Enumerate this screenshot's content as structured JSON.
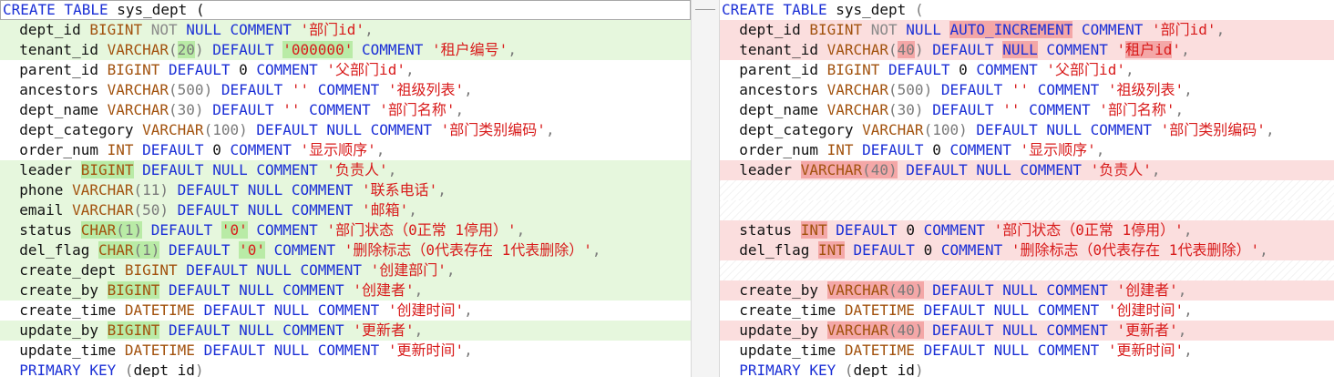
{
  "colors": {
    "keyword": "#1b2fd6",
    "type": "#a2520e",
    "string": "#d81b1b",
    "left_changed_bg": "#e6f7dd",
    "left_highlight": "#b9eba6",
    "right_changed_bg": "#fbdede",
    "right_highlight": "#f4a7a7"
  },
  "left": {
    "lines": [
      {
        "changed": false,
        "first": true,
        "segs": [
          [
            "kw",
            "CREATE TABLE "
          ],
          [
            "id",
            "sys_dept "
          ],
          [
            "id",
            "("
          ]
        ]
      },
      {
        "changed": true,
        "segs": [
          [
            "id",
            "  dept_id "
          ],
          [
            "ty",
            "BIGINT "
          ],
          [
            "dim",
            "NOT "
          ],
          [
            "kw",
            "NULL COMMENT "
          ],
          [
            "st",
            "'部门id'"
          ],
          [
            "pn",
            ","
          ]
        ]
      },
      {
        "changed": true,
        "segs": [
          [
            "id",
            "  tenant_id "
          ],
          [
            "ty",
            "VARCHAR"
          ],
          [
            "pn",
            "("
          ],
          [
            "hl",
            "20"
          ],
          [
            "pn",
            ") "
          ],
          [
            "kw",
            "DEFAULT "
          ],
          [
            "hlst",
            "'000000'"
          ],
          [
            "kw",
            " COMMENT "
          ],
          [
            "st",
            "'租户编号'"
          ],
          [
            "pn",
            ","
          ]
        ]
      },
      {
        "changed": false,
        "segs": [
          [
            "id",
            "  parent_id "
          ],
          [
            "ty",
            "BIGINT "
          ],
          [
            "kw",
            "DEFAULT "
          ],
          [
            "id",
            "0 "
          ],
          [
            "kw",
            "COMMENT "
          ],
          [
            "st",
            "'父部门id'"
          ],
          [
            "pn",
            ","
          ]
        ]
      },
      {
        "changed": false,
        "segs": [
          [
            "id",
            "  ancestors "
          ],
          [
            "ty",
            "VARCHAR"
          ],
          [
            "pn",
            "(500) "
          ],
          [
            "kw",
            "DEFAULT "
          ],
          [
            "st",
            "'' "
          ],
          [
            "kw",
            "COMMENT "
          ],
          [
            "st",
            "'祖级列表'"
          ],
          [
            "pn",
            ","
          ]
        ]
      },
      {
        "changed": false,
        "segs": [
          [
            "id",
            "  dept_name "
          ],
          [
            "ty",
            "VARCHAR"
          ],
          [
            "pn",
            "(30) "
          ],
          [
            "kw",
            "DEFAULT "
          ],
          [
            "st",
            "'' "
          ],
          [
            "kw",
            "COMMENT "
          ],
          [
            "st",
            "'部门名称'"
          ],
          [
            "pn",
            ","
          ]
        ]
      },
      {
        "changed": false,
        "segs": [
          [
            "id",
            "  dept_category "
          ],
          [
            "ty",
            "VARCHAR"
          ],
          [
            "pn",
            "(100) "
          ],
          [
            "kw",
            "DEFAULT NULL COMMENT "
          ],
          [
            "st",
            "'部门类别编码'"
          ],
          [
            "pn",
            ","
          ]
        ]
      },
      {
        "changed": false,
        "segs": [
          [
            "id",
            "  order_num "
          ],
          [
            "ty",
            "INT "
          ],
          [
            "kw",
            "DEFAULT "
          ],
          [
            "id",
            "0 "
          ],
          [
            "kw",
            "COMMENT "
          ],
          [
            "st",
            "'显示顺序'"
          ],
          [
            "pn",
            ","
          ]
        ]
      },
      {
        "changed": true,
        "segs": [
          [
            "id",
            "  leader "
          ],
          [
            "hlty",
            "BIGINT"
          ],
          [
            "kw",
            " DEFAULT NULL COMMENT "
          ],
          [
            "st",
            "'负责人'"
          ],
          [
            "pn",
            ","
          ]
        ]
      },
      {
        "changed": true,
        "segs": [
          [
            "id",
            "  phone "
          ],
          [
            "ty",
            "VARCHAR"
          ],
          [
            "pn",
            "(11) "
          ],
          [
            "kw",
            "DEFAULT NULL COMMENT "
          ],
          [
            "st",
            "'联系电话'"
          ],
          [
            "pn",
            ","
          ]
        ]
      },
      {
        "changed": true,
        "segs": [
          [
            "id",
            "  email "
          ],
          [
            "ty",
            "VARCHAR"
          ],
          [
            "pn",
            "(50) "
          ],
          [
            "kw",
            "DEFAULT NULL COMMENT "
          ],
          [
            "st",
            "'邮箱'"
          ],
          [
            "pn",
            ","
          ]
        ]
      },
      {
        "changed": true,
        "segs": [
          [
            "id",
            "  status "
          ],
          [
            "hlty",
            "CHAR"
          ],
          [
            "hl",
            "(1)"
          ],
          [
            "kw",
            " DEFAULT "
          ],
          [
            "hlst",
            "'0'"
          ],
          [
            "kw",
            " COMMENT "
          ],
          [
            "st",
            "'部门状态（0正常 1停用）'"
          ],
          [
            "pn",
            ","
          ]
        ]
      },
      {
        "changed": true,
        "segs": [
          [
            "id",
            "  del_flag "
          ],
          [
            "hlty",
            "CHAR"
          ],
          [
            "hl",
            "(1)"
          ],
          [
            "kw",
            " DEFAULT "
          ],
          [
            "hlst",
            "'0'"
          ],
          [
            "kw",
            " COMMENT "
          ],
          [
            "st",
            "'删除标志（0代表存在 1代表删除）'"
          ],
          [
            "pn",
            ","
          ]
        ]
      },
      {
        "changed": true,
        "segs": [
          [
            "id",
            "  create_dept "
          ],
          [
            "ty",
            "BIGINT "
          ],
          [
            "kw",
            "DEFAULT NULL COMMENT "
          ],
          [
            "st",
            "'创建部门'"
          ],
          [
            "pn",
            ","
          ]
        ]
      },
      {
        "changed": true,
        "segs": [
          [
            "id",
            "  create_by "
          ],
          [
            "hlty",
            "BIGINT"
          ],
          [
            "kw",
            " DEFAULT NULL COMMENT "
          ],
          [
            "st",
            "'创建者'"
          ],
          [
            "pn",
            ","
          ]
        ]
      },
      {
        "changed": false,
        "segs": [
          [
            "id",
            "  create_time "
          ],
          [
            "ty",
            "DATETIME "
          ],
          [
            "kw",
            "DEFAULT NULL COMMENT "
          ],
          [
            "st",
            "'创建时间'"
          ],
          [
            "pn",
            ","
          ]
        ]
      },
      {
        "changed": true,
        "segs": [
          [
            "id",
            "  update_by "
          ],
          [
            "hlty",
            "BIGINT"
          ],
          [
            "kw",
            " DEFAULT NULL COMMENT "
          ],
          [
            "st",
            "'更新者'"
          ],
          [
            "pn",
            ","
          ]
        ]
      },
      {
        "changed": false,
        "segs": [
          [
            "id",
            "  update_time "
          ],
          [
            "ty",
            "DATETIME "
          ],
          [
            "kw",
            "DEFAULT NULL COMMENT "
          ],
          [
            "st",
            "'更新时间'"
          ],
          [
            "pn",
            ","
          ]
        ]
      },
      {
        "changed": false,
        "segs": [
          [
            "kw",
            "  PRIMARY KEY "
          ],
          [
            "pn",
            "("
          ],
          [
            "id",
            "dept_id"
          ],
          [
            "pn",
            ")"
          ]
        ]
      }
    ]
  },
  "right": {
    "lines": [
      {
        "changed": false,
        "segs": [
          [
            "kw",
            "CREATE TABLE "
          ],
          [
            "id",
            "sys_dept "
          ],
          [
            "pn",
            "("
          ]
        ]
      },
      {
        "changed": true,
        "segs": [
          [
            "id",
            "  dept_id "
          ],
          [
            "ty",
            "BIGINT "
          ],
          [
            "dim",
            "NOT "
          ],
          [
            "kw",
            "NULL "
          ],
          [
            "hlkw",
            "AUTO_INCREMENT"
          ],
          [
            "kw",
            " COMMENT "
          ],
          [
            "st",
            "'部门id'"
          ],
          [
            "pn",
            ","
          ]
        ]
      },
      {
        "changed": true,
        "segs": [
          [
            "id",
            "  tenant_id "
          ],
          [
            "ty",
            "VARCHAR"
          ],
          [
            "pn",
            "("
          ],
          [
            "hl",
            "40"
          ],
          [
            "pn",
            ") "
          ],
          [
            "kw",
            "DEFAULT "
          ],
          [
            "hlkw",
            "NULL"
          ],
          [
            "kw",
            " COMMENT "
          ],
          [
            "st",
            "'"
          ],
          [
            "hlst",
            "租户id"
          ],
          [
            "st",
            "'"
          ],
          [
            "pn",
            ","
          ]
        ]
      },
      {
        "changed": false,
        "segs": [
          [
            "id",
            "  parent_id "
          ],
          [
            "ty",
            "BIGINT "
          ],
          [
            "kw",
            "DEFAULT "
          ],
          [
            "id",
            "0 "
          ],
          [
            "kw",
            "COMMENT "
          ],
          [
            "st",
            "'父部门id'"
          ],
          [
            "pn",
            ","
          ]
        ]
      },
      {
        "changed": false,
        "segs": [
          [
            "id",
            "  ancestors "
          ],
          [
            "ty",
            "VARCHAR"
          ],
          [
            "pn",
            "(500) "
          ],
          [
            "kw",
            "DEFAULT "
          ],
          [
            "st",
            "'' "
          ],
          [
            "kw",
            "COMMENT "
          ],
          [
            "st",
            "'祖级列表'"
          ],
          [
            "pn",
            ","
          ]
        ]
      },
      {
        "changed": false,
        "segs": [
          [
            "id",
            "  dept_name "
          ],
          [
            "ty",
            "VARCHAR"
          ],
          [
            "pn",
            "(30) "
          ],
          [
            "kw",
            "DEFAULT "
          ],
          [
            "st",
            "'' "
          ],
          [
            "kw",
            "COMMENT "
          ],
          [
            "st",
            "'部门名称'"
          ],
          [
            "pn",
            ","
          ]
        ]
      },
      {
        "changed": false,
        "segs": [
          [
            "id",
            "  dept_category "
          ],
          [
            "ty",
            "VARCHAR"
          ],
          [
            "pn",
            "(100) "
          ],
          [
            "kw",
            "DEFAULT NULL COMMENT "
          ],
          [
            "st",
            "'部门类别编码'"
          ],
          [
            "pn",
            ","
          ]
        ]
      },
      {
        "changed": false,
        "segs": [
          [
            "id",
            "  order_num "
          ],
          [
            "ty",
            "INT "
          ],
          [
            "kw",
            "DEFAULT "
          ],
          [
            "id",
            "0 "
          ],
          [
            "kw",
            "COMMENT "
          ],
          [
            "st",
            "'显示顺序'"
          ],
          [
            "pn",
            ","
          ]
        ]
      },
      {
        "changed": true,
        "segs": [
          [
            "id",
            "  leader "
          ],
          [
            "hlty",
            "VARCHAR"
          ],
          [
            "hl",
            "(40)"
          ],
          [
            "kw",
            " DEFAULT NULL COMMENT "
          ],
          [
            "st",
            "'负责人'"
          ],
          [
            "pn",
            ","
          ]
        ]
      },
      {
        "blank": true,
        "segs": []
      },
      {
        "blank": true,
        "segs": []
      },
      {
        "changed": true,
        "segs": [
          [
            "id",
            "  status "
          ],
          [
            "hlty",
            "INT"
          ],
          [
            "kw",
            " DEFAULT "
          ],
          [
            "id",
            "0 "
          ],
          [
            "kw",
            "COMMENT "
          ],
          [
            "st",
            "'部门状态（0正常 1停用）'"
          ],
          [
            "pn",
            ","
          ]
        ]
      },
      {
        "changed": true,
        "segs": [
          [
            "id",
            "  del_flag "
          ],
          [
            "hlty",
            "INT"
          ],
          [
            "kw",
            " DEFAULT "
          ],
          [
            "id",
            "0 "
          ],
          [
            "kw",
            "COMMENT "
          ],
          [
            "st",
            "'删除标志（0代表存在 1代表删除）'"
          ],
          [
            "pn",
            ","
          ]
        ]
      },
      {
        "blank": true,
        "segs": []
      },
      {
        "changed": true,
        "segs": [
          [
            "id",
            "  create_by "
          ],
          [
            "hlty",
            "VARCHAR"
          ],
          [
            "hl",
            "(40)"
          ],
          [
            "kw",
            " DEFAULT NULL COMMENT "
          ],
          [
            "st",
            "'创建者'"
          ],
          [
            "pn",
            ","
          ]
        ]
      },
      {
        "changed": false,
        "segs": [
          [
            "id",
            "  create_time "
          ],
          [
            "ty",
            "DATETIME "
          ],
          [
            "kw",
            "DEFAULT NULL COMMENT "
          ],
          [
            "st",
            "'创建时间'"
          ],
          [
            "pn",
            ","
          ]
        ]
      },
      {
        "changed": true,
        "segs": [
          [
            "id",
            "  update_by "
          ],
          [
            "hlty",
            "VARCHAR"
          ],
          [
            "hl",
            "(40)"
          ],
          [
            "kw",
            " DEFAULT NULL COMMENT "
          ],
          [
            "st",
            "'更新者'"
          ],
          [
            "pn",
            ","
          ]
        ]
      },
      {
        "changed": false,
        "segs": [
          [
            "id",
            "  update_time "
          ],
          [
            "ty",
            "DATETIME "
          ],
          [
            "kw",
            "DEFAULT NULL COMMENT "
          ],
          [
            "st",
            "'更新时间'"
          ],
          [
            "pn",
            ","
          ]
        ]
      },
      {
        "changed": false,
        "segs": [
          [
            "kw",
            "  PRIMARY KEY "
          ],
          [
            "pn",
            "("
          ],
          [
            "id",
            "dept_id"
          ],
          [
            "pn",
            ")"
          ]
        ]
      }
    ]
  }
}
